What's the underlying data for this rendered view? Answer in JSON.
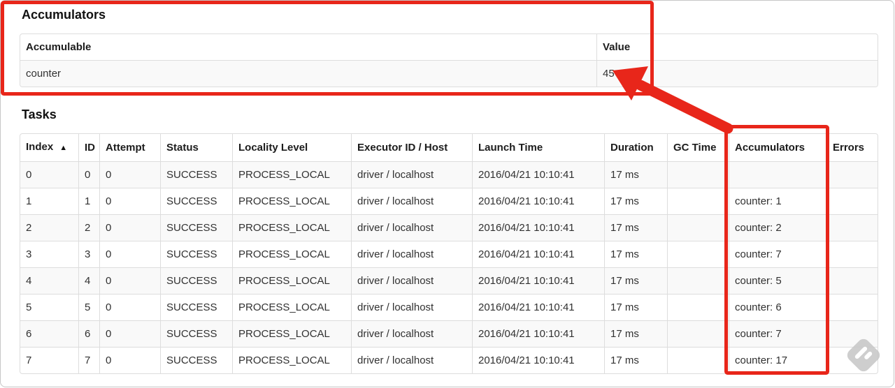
{
  "annotations": {
    "color": "#e8261a",
    "note": "red emphasis box around Accumulators section, red box around Accumulators column, arrow pointing to value 45"
  },
  "accumulators": {
    "heading": "Accumulators",
    "table": {
      "columns": [
        "Accumulable",
        "Value"
      ],
      "rows": [
        {
          "accumulable": "counter",
          "value": "45"
        }
      ]
    }
  },
  "tasks": {
    "heading": "Tasks",
    "table": {
      "columns": [
        "Index",
        "ID",
        "Attempt",
        "Status",
        "Locality Level",
        "Executor ID / Host",
        "Launch Time",
        "Duration",
        "GC Time",
        "Accumulators",
        "Errors"
      ],
      "sort_indicator": "▲",
      "sorted_column": "Index",
      "rows": [
        {
          "index": "0",
          "id": "0",
          "attempt": "0",
          "status": "SUCCESS",
          "locality_level": "PROCESS_LOCAL",
          "executor_id_host": "driver / localhost",
          "launch_time": "2016/04/21 10:10:41",
          "duration": "17 ms",
          "gc_time": "",
          "accumulators": "",
          "errors": ""
        },
        {
          "index": "1",
          "id": "1",
          "attempt": "0",
          "status": "SUCCESS",
          "locality_level": "PROCESS_LOCAL",
          "executor_id_host": "driver / localhost",
          "launch_time": "2016/04/21 10:10:41",
          "duration": "17 ms",
          "gc_time": "",
          "accumulators": "counter: 1",
          "errors": ""
        },
        {
          "index": "2",
          "id": "2",
          "attempt": "0",
          "status": "SUCCESS",
          "locality_level": "PROCESS_LOCAL",
          "executor_id_host": "driver / localhost",
          "launch_time": "2016/04/21 10:10:41",
          "duration": "17 ms",
          "gc_time": "",
          "accumulators": "counter: 2",
          "errors": ""
        },
        {
          "index": "3",
          "id": "3",
          "attempt": "0",
          "status": "SUCCESS",
          "locality_level": "PROCESS_LOCAL",
          "executor_id_host": "driver / localhost",
          "launch_time": "2016/04/21 10:10:41",
          "duration": "17 ms",
          "gc_time": "",
          "accumulators": "counter: 7",
          "errors": ""
        },
        {
          "index": "4",
          "id": "4",
          "attempt": "0",
          "status": "SUCCESS",
          "locality_level": "PROCESS_LOCAL",
          "executor_id_host": "driver / localhost",
          "launch_time": "2016/04/21 10:10:41",
          "duration": "17 ms",
          "gc_time": "",
          "accumulators": "counter: 5",
          "errors": ""
        },
        {
          "index": "5",
          "id": "5",
          "attempt": "0",
          "status": "SUCCESS",
          "locality_level": "PROCESS_LOCAL",
          "executor_id_host": "driver / localhost",
          "launch_time": "2016/04/21 10:10:41",
          "duration": "17 ms",
          "gc_time": "",
          "accumulators": "counter: 6",
          "errors": ""
        },
        {
          "index": "6",
          "id": "6",
          "attempt": "0",
          "status": "SUCCESS",
          "locality_level": "PROCESS_LOCAL",
          "executor_id_host": "driver / localhost",
          "launch_time": "2016/04/21 10:10:41",
          "duration": "17 ms",
          "gc_time": "",
          "accumulators": "counter: 7",
          "errors": ""
        },
        {
          "index": "7",
          "id": "7",
          "attempt": "0",
          "status": "SUCCESS",
          "locality_level": "PROCESS_LOCAL",
          "executor_id_host": "driver / localhost",
          "launch_time": "2016/04/21 10:10:41",
          "duration": "17 ms",
          "gc_time": "",
          "accumulators": "counter: 17",
          "errors": ""
        }
      ]
    }
  },
  "watermark_icon": "skitch-logo",
  "watermark_color": "#c9c9c9"
}
